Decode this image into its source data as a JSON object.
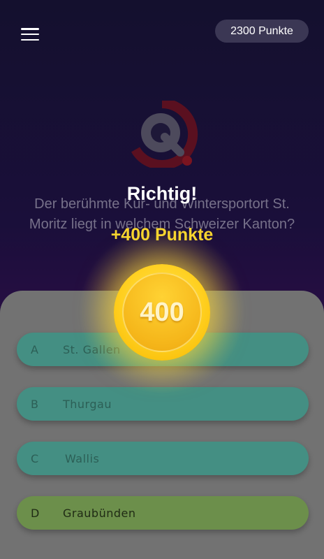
{
  "header": {
    "menu_icon": "hamburger-menu-icon",
    "points_label": "2300 Punkte"
  },
  "logo": {
    "icon": "quiz-q-logo-icon",
    "colors": {
      "ring": "#a0201f",
      "letter": "#7a7888",
      "dot": "#c42020"
    }
  },
  "question": {
    "text": "Der berühmte Kur- und Wintersportort St. Moritz liegt in welchem Schweizer Kanton?"
  },
  "answers": [
    {
      "letter": "A",
      "text": "St. Gallen",
      "color": "#448f83"
    },
    {
      "letter": "B",
      "text": "Thurgau",
      "color": "#448f83"
    },
    {
      "letter": "C",
      "text": "Wallis",
      "color": "#448f83"
    },
    {
      "letter": "D",
      "text": "Graubünden",
      "color": "#6c8f4b"
    }
  ],
  "feedback": {
    "title": "Richtig!",
    "points_gained": "+400 Punkte",
    "coin_value": "400",
    "coin_color": "#ffcf1f"
  }
}
